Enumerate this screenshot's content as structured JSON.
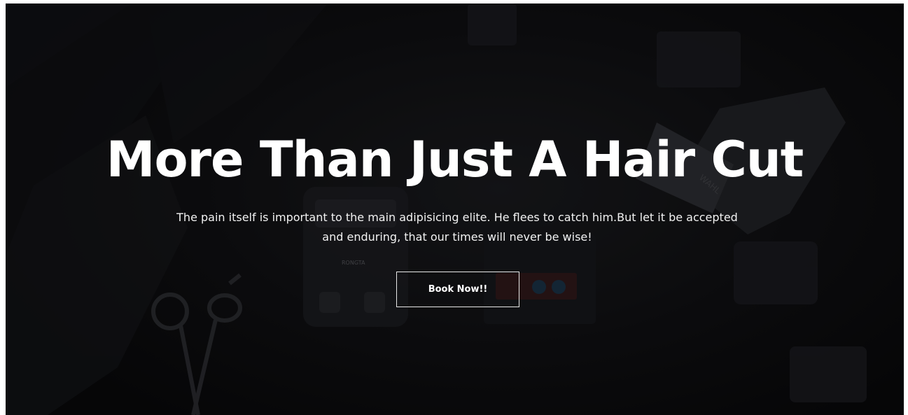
{
  "hero": {
    "title": "More Than Just A Hair Cut",
    "subtitle": "The pain itself is important to the main adipisicing elite. He flees to catch him.But let it be accepted and enduring, that our times will never be wise!",
    "cta_label": "Book Now!!"
  },
  "background": {
    "description_icons": [
      "cape-image",
      "scissors-image",
      "receipt-printer-image",
      "card-reader-image",
      "hair-clipper-image",
      "comb-image"
    ],
    "printer_brand": "RONGTA",
    "clipper_brand": "WAHL"
  },
  "colors": {
    "text": "#ffffff",
    "background": "#0e0e10",
    "button_border": "#e8e8e8"
  }
}
